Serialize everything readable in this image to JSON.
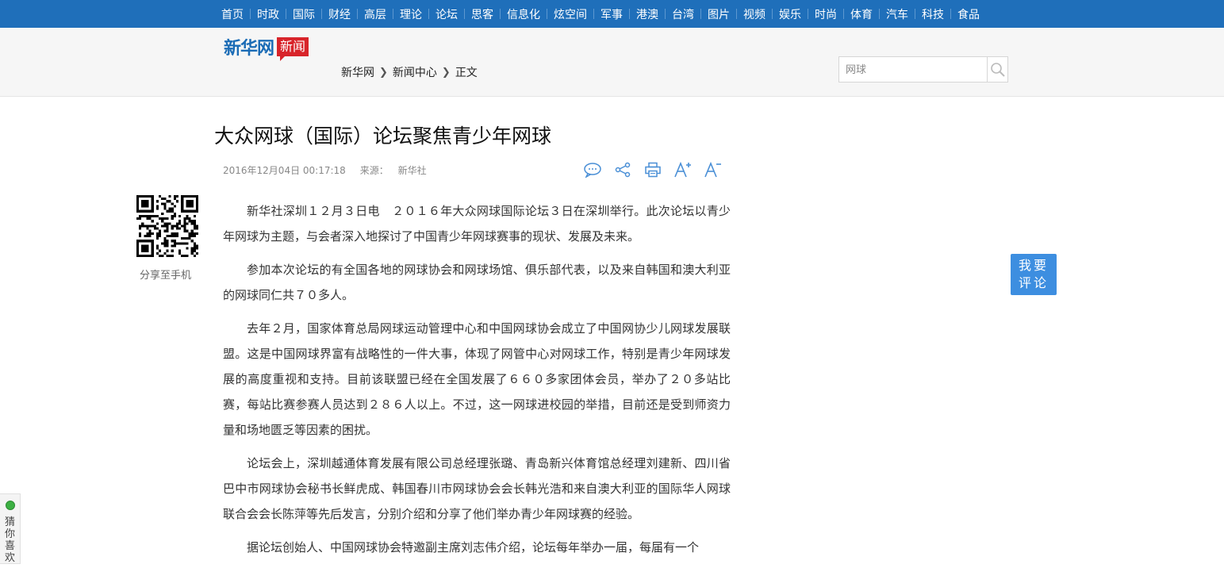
{
  "nav": {
    "items": [
      "首页",
      "时政",
      "国际",
      "财经",
      "高层",
      "理论",
      "论坛",
      "思客",
      "信息化",
      "炫空间",
      "军事",
      "港澳",
      "台湾",
      "图片",
      "视频",
      "娱乐",
      "时尚",
      "体育",
      "汽车",
      "科技",
      "食品"
    ]
  },
  "header": {
    "logo_main": "新华网",
    "logo_tag": "新闻",
    "breadcrumb": [
      "新华网",
      "新闻中心",
      "正文"
    ],
    "search_value": "网球"
  },
  "article": {
    "title": "大众网球（国际）论坛聚焦青少年网球",
    "date": "2016年12月04日 00:17:18",
    "source_label": "来源：",
    "source": "新华社",
    "paragraphs": [
      "新华社深圳１２月３日电　２０１６年大众网球国际论坛３日在深圳举行。此次论坛以青少年网球为主题，与会者深入地探讨了中国青少年网球赛事的现状、发展及未来。",
      "参加本次论坛的有全国各地的网球协会和网球场馆、俱乐部代表，以及来自韩国和澳大利亚的网球同仁共７０多人。",
      "去年２月，国家体育总局网球运动管理中心和中国网球协会成立了中国网协少儿网球发展联盟。这是中国网球界富有战略性的一件大事，体现了网管中心对网球工作，特别是青少年网球发展的高度重视和支持。目前该联盟已经在全国发展了６６０多家团体会员，举办了２０多站比赛，每站比赛参赛人员达到２８６人以上。不过，这一网球进校园的举措，目前还是受到师资力量和场地匮乏等因素的困扰。",
      "论坛会上，深圳越通体育发展有限公司总经理张璐、青岛新兴体育馆总经理刘建新、四川省巴中市网球协会秘书长鲜虎成、韩国春川市网球协会会长韩光浩和来自澳大利亚的国际华人网球联合会会长陈萍等先后发言，分别介绍和分享了他们举办青少年网球赛的经验。",
      "据论坛创始人、中国网球协会特邀副主席刘志伟介绍，论坛每年举办一届，每届有一个"
    ]
  },
  "sidebar": {
    "qr_label": "分享至手机",
    "comment_line1": "我要",
    "comment_line2": "评论",
    "guess_label": "猜你喜欢"
  },
  "colors": {
    "nav_bg": "#1f6fba",
    "accent_red": "#d8242a",
    "logo_blue": "#1b6cb6",
    "comment_bg": "#3d8ee0",
    "icon_blue": "#4a8fd6"
  },
  "icons": [
    "comment-icon",
    "share-icon",
    "print-icon",
    "font-increase-icon",
    "font-decrease-icon",
    "search-icon",
    "qr-code"
  ]
}
